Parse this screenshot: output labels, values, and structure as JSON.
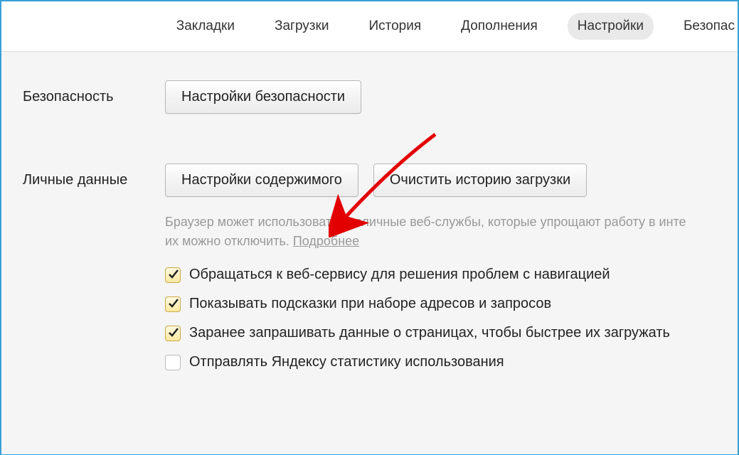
{
  "nav": {
    "items": [
      {
        "label": "Закладки",
        "active": false
      },
      {
        "label": "Загрузки",
        "active": false
      },
      {
        "label": "История",
        "active": false
      },
      {
        "label": "Дополнения",
        "active": false
      },
      {
        "label": "Настройки",
        "active": true
      },
      {
        "label": "Безопас",
        "active": false
      }
    ]
  },
  "sections": {
    "security": {
      "title": "Безопасность",
      "button": "Настройки безопасности"
    },
    "personal": {
      "title": "Личные данные",
      "content_button": "Настройки содержимого",
      "clear_button": "Очистить историю загрузки",
      "desc_1": "Браузер может использовать различные веб-службы, которые упрощают работу в инте",
      "desc_2": "их можно отключить. ",
      "more_link": "Подробнее",
      "checks": [
        {
          "label": "Обращаться к веб-сервису для решения проблем с навигацией",
          "checked": true
        },
        {
          "label": "Показывать подсказки при наборе адресов и запросов",
          "checked": true
        },
        {
          "label": "Заранее запрашивать данные о страницах, чтобы быстрее их загружать",
          "checked": true
        },
        {
          "label": "Отправлять Яндексу статистику использования",
          "checked": false
        }
      ]
    }
  }
}
